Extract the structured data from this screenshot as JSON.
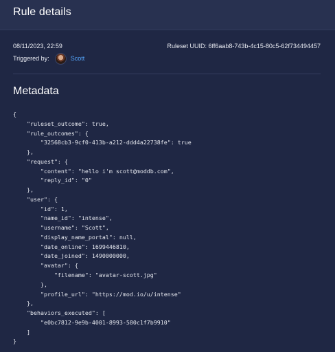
{
  "header": {
    "title": "Rule details"
  },
  "meta": {
    "timestamp": "08/11/2023, 22:59",
    "ruleset_uuid": "Ruleset UUID: 6ff6aab8-743b-4c15-80c5-62f734494457",
    "triggered_by_label": "Triggered by:",
    "user_name": "Scott"
  },
  "metadata": {
    "title": "Metadata",
    "json_text": "{\n    \"ruleset_outcome\": true,\n    \"rule_outcomes\": {\n        \"32568cb3-9cf0-413b-a212-ddd4a22738fe\": true\n    },\n    \"request\": {\n        \"content\": \"hello i'm scott@moddb.com\",\n        \"reply_id\": \"0\"\n    },\n    \"user\": {\n        \"id\": 1,\n        \"name_id\": \"intense\",\n        \"username\": \"Scott\",\n        \"display_name_portal\": null,\n        \"date_online\": 1699446810,\n        \"date_joined\": 1490000000,\n        \"avatar\": {\n            \"filename\": \"avatar-scott.jpg\"\n        },\n        \"profile_url\": \"https://mod.io/u/intense\"\n    },\n    \"behaviors_executed\": [\n        \"e0bc7812-9e9b-4001-8993-580c1f7b9910\"\n    ]\n}"
  },
  "colors": {
    "background": "#1f2744",
    "header": "#283150",
    "link": "#55a8ff",
    "text": "#e9ebf2"
  }
}
